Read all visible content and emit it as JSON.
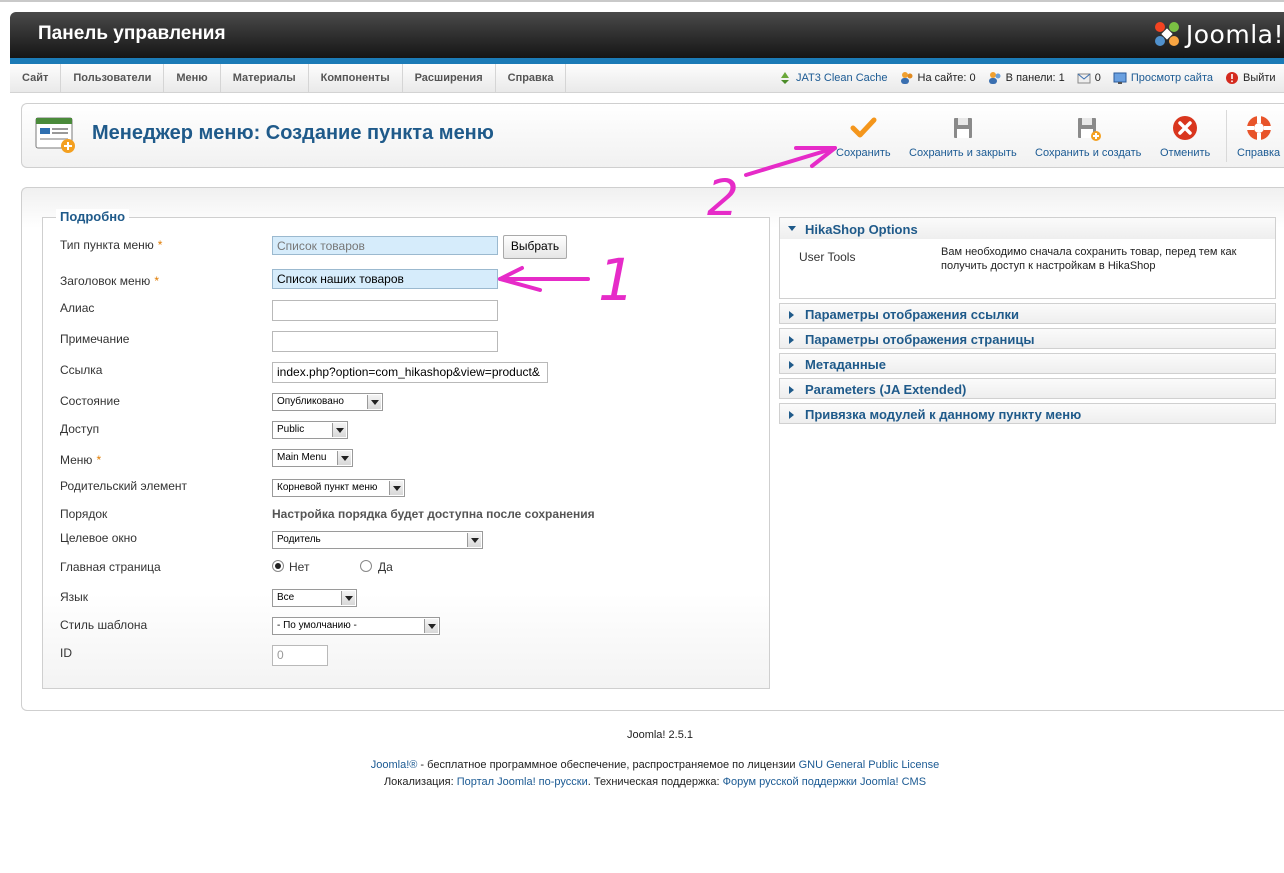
{
  "header": {
    "title": "Панель управления",
    "logo_text": "Joomla!"
  },
  "menubar": {
    "items": [
      "Сайт",
      "Пользователи",
      "Меню",
      "Материалы",
      "Компоненты",
      "Расширения",
      "Справка"
    ],
    "status": {
      "cache": "JAT3 Clean Cache",
      "on_site": "На сайте: 0",
      "in_panel": "В панели: 1",
      "messages": "0",
      "view_site": "Просмотр сайта",
      "logout": "Выйти"
    }
  },
  "toolbar": {
    "page_title": "Менеджер меню: Создание пункта меню",
    "save": "Сохранить",
    "save_close": "Сохранить и закрыть",
    "save_new": "Сохранить и создать",
    "cancel": "Отменить",
    "help": "Справка"
  },
  "form": {
    "legend": "Подробно",
    "type_label": "Тип пункта меню",
    "type_value": "Список товаров",
    "select_button": "Выбрать",
    "title_label": "Заголовок меню",
    "title_value": "Список наших товаров",
    "alias_label": "Алиас",
    "alias_value": "",
    "note_label": "Примечание",
    "note_value": "",
    "link_label": "Ссылка",
    "link_value": "index.php?option=com_hikashop&view=product&",
    "state_label": "Состояние",
    "state_value": "Опубликовано",
    "access_label": "Доступ",
    "access_value": "Public",
    "menu_label": "Меню",
    "menu_value": "Main Menu",
    "parent_label": "Родительский элемент",
    "parent_value": "Корневой пункт меню",
    "order_label": "Порядок",
    "order_value": "Настройка порядка будет доступна после сохранения",
    "target_label": "Целевое окно",
    "target_value": "Родитель",
    "home_label": "Главная страница",
    "home_no": "Нет",
    "home_yes": "Да",
    "lang_label": "Язык",
    "lang_value": "Все",
    "style_label": "Стиль шаблона",
    "style_value": "- По умолчанию -",
    "id_label": "ID",
    "id_value": "0",
    "required_mark": "*"
  },
  "panels": {
    "hikashop": {
      "title": "HikaShop Options",
      "label": "User Tools",
      "text": "Вам необходимо сначала сохранить товар, перед тем как получить доступ к настройкам в HikaShop"
    },
    "others": [
      "Параметры отображения ссылки",
      "Параметры отображения страницы",
      "Метаданные",
      "Parameters (JA Extended)",
      "Привязка модулей к данному пункту меню"
    ]
  },
  "footer": {
    "version": "Joomla! 2.5.1",
    "line1_link1": "Joomla!®",
    "line1_text": " - бесплатное программное обеспечение, распространяемое по лицензии ",
    "line1_link2": "GNU General Public License",
    "line2_text1": "Локализация: ",
    "line2_link1": "Портал Joomla! по-русски",
    "line2_text2": ". Техническая поддержка: ",
    "line2_link2": "Форум русской поддержки Joomla! CMS"
  },
  "annotations": {
    "one": "1",
    "two": "2"
  },
  "colors": {
    "accent": "#1b7bb7",
    "title": "#1f5a8a",
    "annotation": "#e62bc8"
  }
}
